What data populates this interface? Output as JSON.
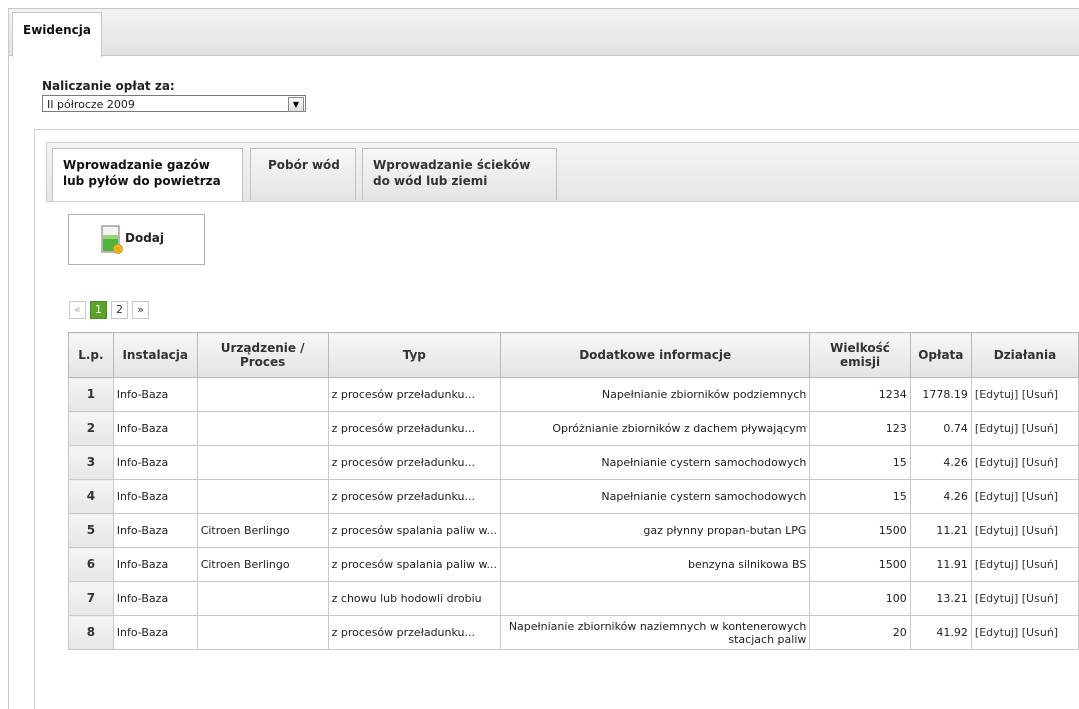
{
  "outer_tab": "Ewidencja",
  "period": {
    "label": "Naliczanie opłat za:",
    "selected": "II półrocze 2009"
  },
  "inner_tabs": [
    {
      "line1": "Wprowadzanie gazów",
      "line2": "lub pyłów do powietrza"
    },
    {
      "line1": "Pobór wód",
      "line2": ""
    },
    {
      "line1": "Wprowadzanie ścieków",
      "line2": "do wód lub ziemi"
    }
  ],
  "add_button": "Dodaj",
  "pager": {
    "prev": "«",
    "pages": [
      "1",
      "2"
    ],
    "next": "»",
    "current": "1"
  },
  "table": {
    "headers": [
      "L.p.",
      "Instalacja",
      "Urządzenie / Proces",
      "Typ",
      "Dodatkowe informacje",
      "Wielkość emisji",
      "Opłata",
      "Działania"
    ],
    "rows": [
      {
        "lp": "1",
        "inst": "Info-Baza",
        "dev": "",
        "typ": "z procesów przeładunku...",
        "info": "Napełnianie zbiorników podziemnych",
        "emis": "1234",
        "fee": "1778.19",
        "act": "[Edytuj] [Usuń]"
      },
      {
        "lp": "2",
        "inst": "Info-Baza",
        "dev": "",
        "typ": "z procesów przeładunku...",
        "info": "Opróżnianie zbiorników z dachem pływającym",
        "emis": "123",
        "fee": "0.74",
        "act": "[Edytuj] [Usuń]"
      },
      {
        "lp": "3",
        "inst": "Info-Baza",
        "dev": "",
        "typ": "z procesów przeładunku...",
        "info": "Napełnianie cystern samochodowych",
        "emis": "15",
        "fee": "4.26",
        "act": "[Edytuj] [Usuń]"
      },
      {
        "lp": "4",
        "inst": "Info-Baza",
        "dev": "",
        "typ": "z procesów przeładunku...",
        "info": "Napełnianie cystern samochodowych",
        "emis": "15",
        "fee": "4.26",
        "act": "[Edytuj] [Usuń]"
      },
      {
        "lp": "5",
        "inst": "Info-Baza",
        "dev": "Citroen Berlingo",
        "typ": "z procesów spalania paliw w...",
        "info": "gaz płynny propan-butan LPG",
        "emis": "1500",
        "fee": "11.21",
        "act": "[Edytuj] [Usuń]"
      },
      {
        "lp": "6",
        "inst": "Info-Baza",
        "dev": "Citroen Berlingo",
        "typ": "z procesów spalania paliw w...",
        "info": "benzyna silnikowa BS",
        "emis": "1500",
        "fee": "11.91",
        "act": "[Edytuj] [Usuń]"
      },
      {
        "lp": "7",
        "inst": "Info-Baza",
        "dev": "",
        "typ": "z chowu lub hodowli drobiu",
        "info": "",
        "emis": "100",
        "fee": "13.21",
        "act": "[Edytuj] [Usuń]"
      },
      {
        "lp": "8",
        "inst": "Info-Baza",
        "dev": "",
        "typ": "z procesów przeładunku...",
        "info": "Napełnianie zbiorników naziemnych w kontenerowych stacjach paliw",
        "emis": "20",
        "fee": "41.92",
        "act": "[Edytuj] [Usuń]"
      }
    ]
  }
}
